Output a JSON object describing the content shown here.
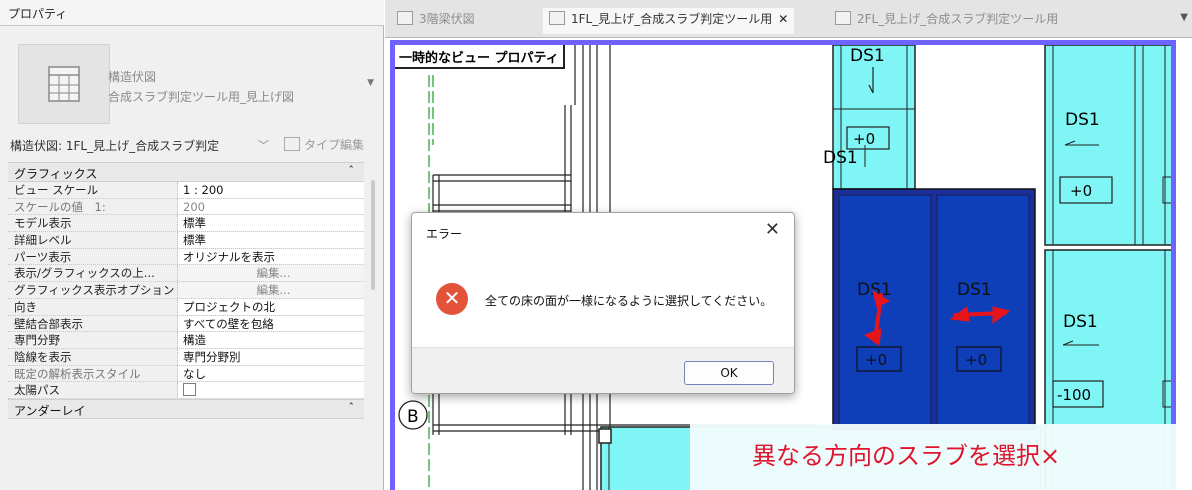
{
  "properties": {
    "title": "プロパティ",
    "type_name_line1": "構造伏図",
    "type_name_line2": "合成スラブ判定ツール用_見上げ図",
    "instance_selector": "構造伏図: 1FL_見上げ_合成スラブ判定",
    "type_edit_label": "タイプ編集",
    "groups": {
      "graphics": "グラフィックス",
      "underlay": "アンダーレイ"
    },
    "rows": [
      {
        "name": "ビュー スケール",
        "value": "1 : 200"
      },
      {
        "name": "スケールの値　1:",
        "value": "200"
      },
      {
        "name": "モデル表示",
        "value": "標準"
      },
      {
        "name": "詳細レベル",
        "value": "標準"
      },
      {
        "name": "パーツ表示",
        "value": "オリジナルを表示"
      },
      {
        "name": "表示/グラフィックスの上...",
        "value": "編集..."
      },
      {
        "name": "グラフィックス表示オプション",
        "value": "編集..."
      },
      {
        "name": "向き",
        "value": "プロジェクトの北"
      },
      {
        "name": "壁結合部表示",
        "value": "すべての壁を包絡"
      },
      {
        "name": "専門分野",
        "value": "構造"
      },
      {
        "name": "陰線を表示",
        "value": "専門分野別"
      },
      {
        "name": "既定の解析表示スタイル",
        "value": "なし"
      },
      {
        "name": "太陽パス",
        "value": ""
      }
    ]
  },
  "tabs": [
    {
      "label": "3階梁伏図",
      "active": false
    },
    {
      "label": "1FL_見上げ_合成スラブ判定ツール用",
      "active": true,
      "close": "✕"
    },
    {
      "label": "2FL_見上げ_合成スラブ判定ツール用",
      "active": false
    }
  ],
  "view": {
    "temp_label": "一時的なビュー プロパティ",
    "grid_bubble": "B",
    "slabs": {
      "top_left_label": "DS1",
      "top_left_value": "+0",
      "overlap_label": "DS1",
      "right_top_label": "DS1",
      "right_top_value": "+0",
      "sel_left_label": "DS1",
      "sel_left_value": "+0",
      "sel_right_label": "DS1",
      "sel_right_value": "+0",
      "right_mid_label": "DS1",
      "right_mid_value": "-100"
    },
    "colors": {
      "slab_light": "#7ff5f5",
      "slab_selected": "#0e3fb8",
      "arrow": "#e8141c",
      "view_border": "#6e63ff"
    }
  },
  "dialog": {
    "title": "エラー",
    "close": "✕",
    "icon": "✕",
    "message": "全ての床の面が一様になるように選択してください。",
    "ok_label": "OK"
  },
  "caption": "異なる方向のスラブを選択×"
}
